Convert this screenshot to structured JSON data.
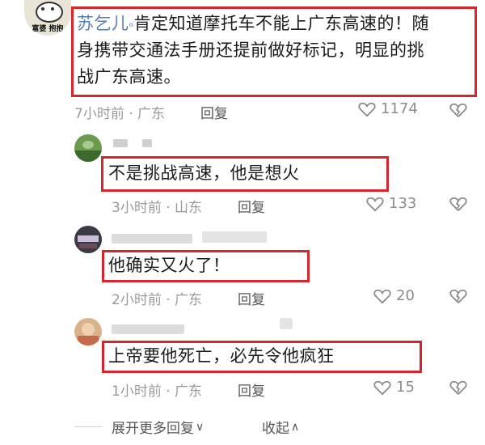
{
  "comments": [
    {
      "username": "苏乞儿",
      "text": "肯定知道摩托车不能上广东高速的！随身携带交通法手册还提前做好标记，明显的挑战广东高速。",
      "line1": "肯定知道摩托车不能上广东高速的！随",
      "line2": "身携带交通法手册还提前做好标记，明显的挑",
      "line3": "战广东高速。",
      "time": "7小时前 · 广东",
      "reply": "回复",
      "likes": "1174",
      "avatar_caption": "富婆 抱抱"
    },
    {
      "text": "不是挑战高速，他是想火",
      "time": "3小时前 · 山东",
      "reply": "回复",
      "likes": "133"
    },
    {
      "text": "他确实又火了！",
      "time": "2小时前 · 广东",
      "reply": "回复",
      "likes": "20"
    },
    {
      "text": "上帝要他死亡，必先令他疯狂",
      "time": "1小时前 · 广东",
      "reply": "回复",
      "likes": "15"
    }
  ],
  "footer": {
    "expand": "展开更多回复",
    "collapse": "收起"
  },
  "colors": {
    "highlight": "#d7262b",
    "username": "#5b7fb0"
  }
}
